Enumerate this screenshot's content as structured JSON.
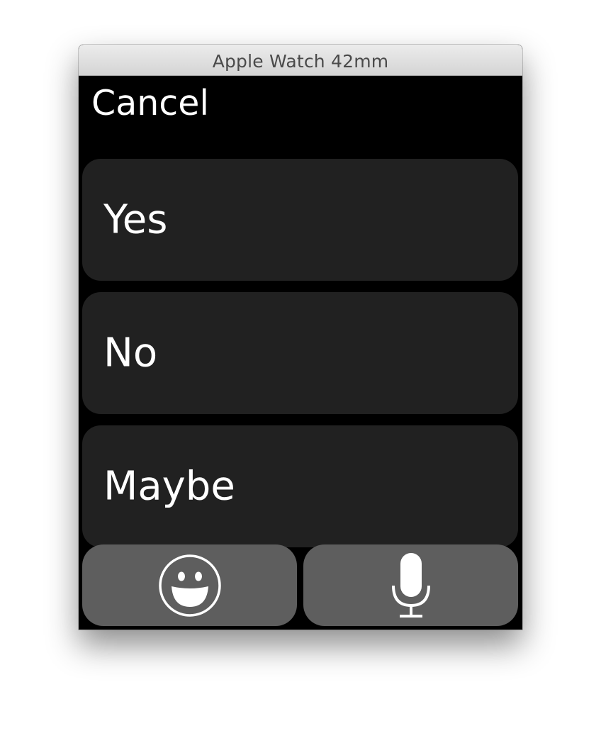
{
  "window": {
    "title": "Apple Watch 42mm"
  },
  "screen": {
    "cancel_label": "Cancel",
    "replies": [
      {
        "label": "Yes"
      },
      {
        "label": "No"
      },
      {
        "label": "Maybe"
      }
    ],
    "bottom_buttons": [
      {
        "icon": "smiley-icon"
      },
      {
        "icon": "microphone-icon"
      }
    ]
  },
  "colors": {
    "screen_background": "#000000",
    "reply_button": "#212121",
    "bottom_button": "#5e5e5e",
    "text": "#ffffff"
  }
}
